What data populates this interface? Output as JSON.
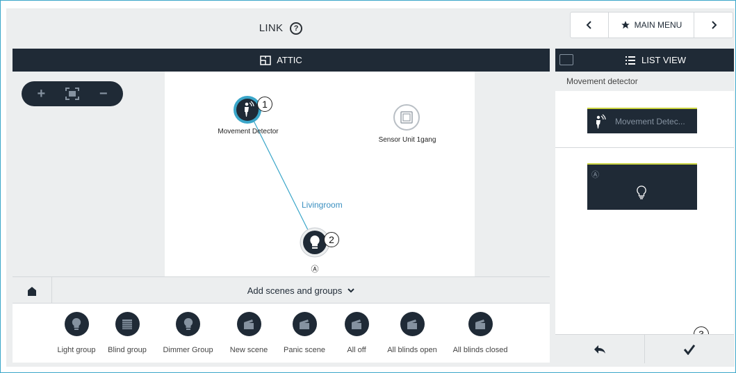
{
  "header": {
    "title": "LINK",
    "help_icon": "help-circle-icon"
  },
  "topnav": {
    "prev": "‹",
    "main_menu": "MAIN MENU",
    "next": "›"
  },
  "map": {
    "room": "ATTIC",
    "zoom": {
      "in": "+",
      "fit": "fit-icon",
      "out": "−"
    },
    "nodes": {
      "movement": {
        "label": "Movement Detector",
        "badge": "1"
      },
      "sensor": {
        "label": "Sensor Unit 1gang"
      },
      "light": {
        "label": "Ⓐ",
        "badge": "2"
      }
    },
    "link_label": "Livingroom"
  },
  "group_bar": {
    "label": "Add scenes and groups"
  },
  "palette": [
    {
      "label": "Light group",
      "icon": "bulb-icon"
    },
    {
      "label": "Blind group",
      "icon": "blind-icon"
    },
    {
      "label": "Dimmer Group",
      "icon": "bulb-icon"
    },
    {
      "label": "New scene",
      "icon": "clapper-icon"
    },
    {
      "label": "Panic scene",
      "icon": "clapper-icon"
    },
    {
      "label": "All off",
      "icon": "clapper-icon"
    },
    {
      "label": "All blinds open",
      "icon": "clapper-icon"
    },
    {
      "label": "All blinds closed",
      "icon": "clapper-icon"
    }
  ],
  "right_panel": {
    "title": "LIST VIEW",
    "subtitle": "Movement detector",
    "card1_label": "Movement Detec...",
    "card2_label": "Ⓐ",
    "badge": "3"
  },
  "colors": {
    "dark": "#1f2a36",
    "accent": "#3aa6c9",
    "highlight": "#c9d23e"
  }
}
